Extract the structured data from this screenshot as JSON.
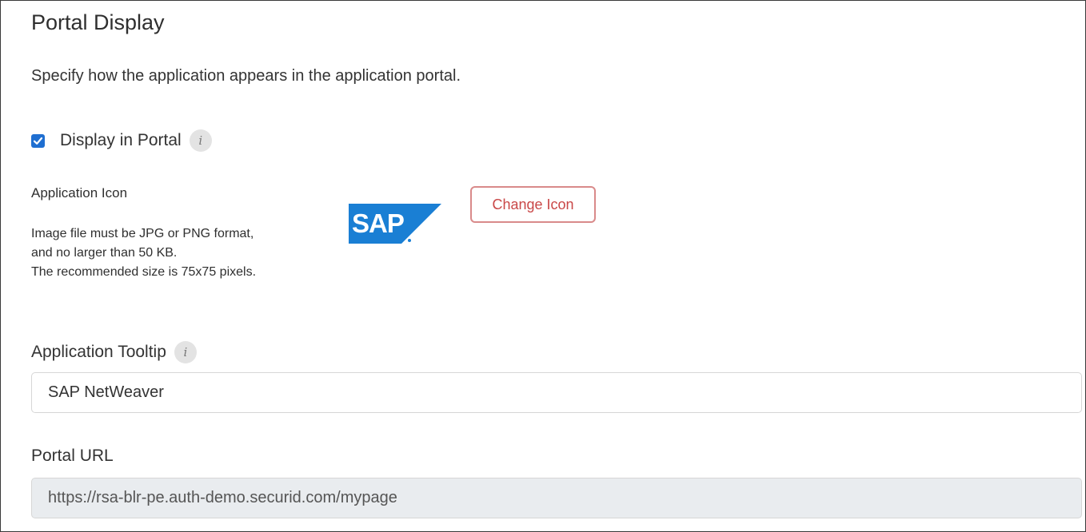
{
  "section": {
    "title": "Portal Display",
    "description": "Specify how the application appears in the application portal."
  },
  "display_in_portal": {
    "label": "Display in Portal",
    "checked": true,
    "info_icon": "info-icon"
  },
  "application_icon": {
    "label": "Application Icon",
    "help_lines": [
      "Image file must be JPG or PNG format,",
      "and no larger than 50 KB.",
      "The recommended size is 75x75 pixels."
    ],
    "logo_name": "sap-logo",
    "change_button_label": "Change Icon"
  },
  "application_tooltip": {
    "label": "Application Tooltip",
    "value": "SAP NetWeaver",
    "info_icon": "info-icon"
  },
  "portal_url": {
    "label": "Portal URL",
    "value": "https://rsa-blr-pe.auth-demo.securid.com/mypage",
    "readonly": true
  },
  "colors": {
    "accent_checkbox": "#1f6fd1",
    "button_text": "#c94747",
    "button_border": "#d98a8a",
    "readonly_bg": "#e9ecef",
    "sap_blue": "#1a7fd4"
  }
}
